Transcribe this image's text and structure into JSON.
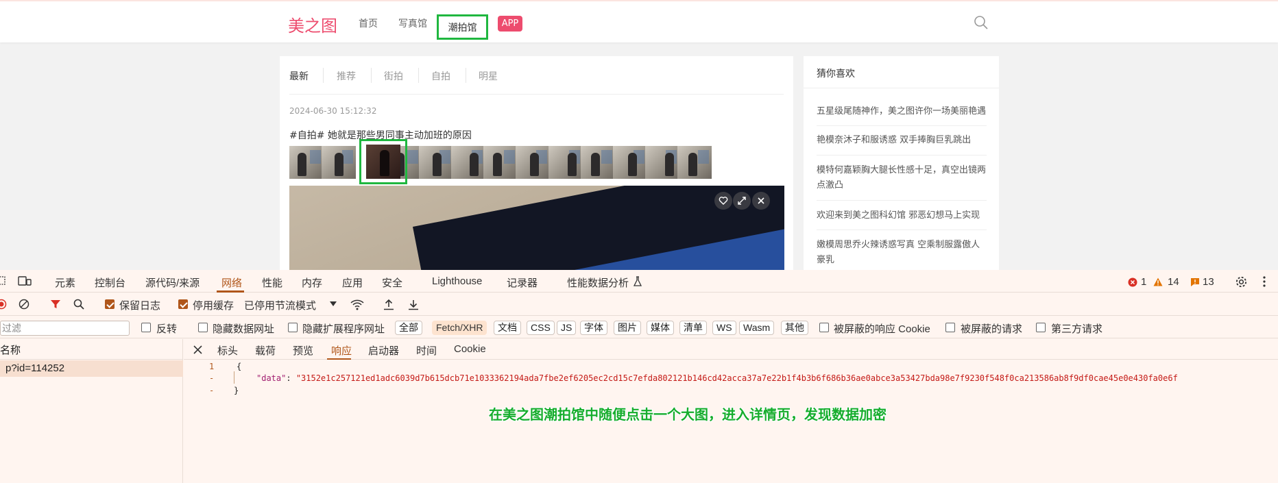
{
  "site": {
    "logo": "美之图",
    "nav": [
      "首页",
      "写真馆",
      "潮拍馆",
      "APP"
    ]
  },
  "content": {
    "tabs": [
      "最新",
      "推荐",
      "街拍",
      "自拍",
      "明星"
    ],
    "post_time": "2024-06-30 15:12:32",
    "post_title": "#自拍# 她就是那些男同事主动加班的原因",
    "thumbnail_count": 13,
    "selected_thumbnail": 3,
    "image_buttons": [
      "heart-icon",
      "expand-icon",
      "close-icon"
    ]
  },
  "sidebar": {
    "title": "猜你喜欢",
    "items": [
      "五星级尾随神作，美之图许你一场美丽艳遇",
      "艳模奈沐子和服诱惑 双手捧胸巨乳跳出",
      "模特何嘉颖胸大腿长性感十足，真空出镜两点激凸",
      "欢迎来到美之图科幻馆 邪恶幻想马上实现",
      "嫩模周思乔火辣诱惑写真 空乘制服露傲人豪乳"
    ]
  },
  "devtools": {
    "tabs": [
      "元素",
      "控制台",
      "源代码/来源",
      "网络",
      "性能",
      "内存",
      "应用",
      "安全",
      "Lighthouse",
      "记录器",
      "性能数据分析"
    ],
    "active_tab": "网络",
    "status": {
      "errors": "1",
      "warnings": "14",
      "issues": "13"
    },
    "toolbar": {
      "preserve_log": "保留日志",
      "disable_cache": "停用缓存",
      "throttle": "已停用节流模式"
    },
    "filter": {
      "placeholder": "过滤",
      "invert": "反转",
      "hide_data_urls": "隐藏数据网址",
      "hide_ext_urls": "隐藏扩展程序网址",
      "types": [
        "全部",
        "Fetch/XHR",
        "文档",
        "CSS",
        "JS",
        "字体",
        "图片",
        "媒体",
        "清单",
        "WS",
        "Wasm",
        "其他"
      ],
      "active_type": "Fetch/XHR",
      "blocked_cookies": "被屏蔽的响应 Cookie",
      "blocked_requests": "被屏蔽的请求",
      "third_party": "第三方请求"
    },
    "requests": {
      "header": "名称",
      "rows": [
        "p?id=114252"
      ]
    },
    "response_tabs": [
      "标头",
      "载荷",
      "预览",
      "响应",
      "启动器",
      "时间",
      "Cookie"
    ],
    "active_response_tab": "响应",
    "response": {
      "line_numbers": [
        "1",
        "-",
        "-"
      ],
      "open_brace": "{",
      "key": "\"data\"",
      "colon": ": ",
      "value": "\"3152e1c257121ed1adc6039d7b615dcb71e1033362194ada7fbe2ef6205ec2cd15c7efda802121b146cd42acca37a7e22b1f4b3b6f686b36ae0abce3a53427bda98e7f9230f548f0ca213586ab8f9df0cae45e0e430fa0e6f",
      "close_brace": "}"
    }
  },
  "caption": "在美之图潮拍馆中随便点击一个大图，进入详情页，发现数据加密",
  "colors": {
    "brand": "#ed4c6e",
    "highlight": "#1fb73f",
    "devtools_accent": "#b0561a"
  }
}
